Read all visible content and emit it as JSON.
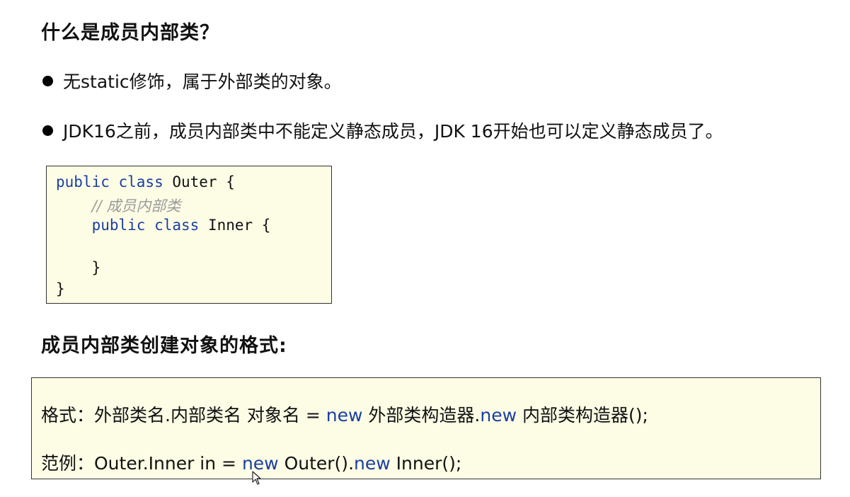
{
  "section1": {
    "title": "什么是成员内部类？",
    "bullets": [
      "无static修饰，属于外部类的对象。",
      "JDK16之前，成员内部类中不能定义静态成员，JDK 16开始也可以定义静态成员了。"
    ]
  },
  "code": {
    "line1": {
      "kw": "public class",
      "rest": " Outer {"
    },
    "line2": {
      "comment": "// 成员内部类"
    },
    "line3": {
      "kw": "public class",
      "rest": " Inner {"
    },
    "line4": "}",
    "line5": "}"
  },
  "section2": {
    "title": "成员内部类创建对象的格式:",
    "format": {
      "prefix": "格式：外部类名.内部类名 对象名 = ",
      "new1": "new",
      "mid": "  外部类构造器.",
      "new2": "new",
      "suffix": " 内部类构造器();"
    },
    "example": {
      "prefix": "范例：Outer.Inner in = ",
      "new1": "new",
      "mid": " Outer().",
      "new2": "new",
      "suffix": "  Inner();"
    }
  },
  "icons": {
    "bullet": "bullet-dot-icon",
    "cursor": "mouse-pointer-icon"
  },
  "colors": {
    "keyword": "#1a3fa0",
    "comment": "#9a9a9a",
    "box_bg": "#fdfde6"
  }
}
